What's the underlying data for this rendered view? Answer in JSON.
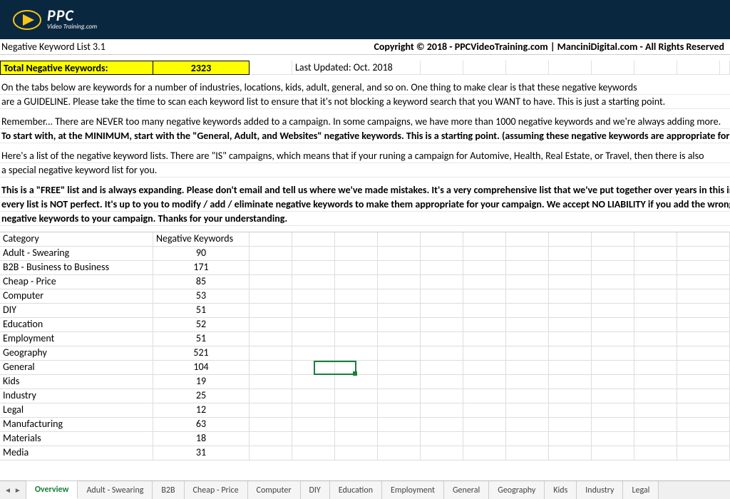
{
  "logo": {
    "main": "PPC",
    "sub": "Video Training.com"
  },
  "header": {
    "title": "Negative Keyword List 3.1",
    "copyright": "Copyright © 2018 - PPCVideoTraining.com | ManciniDigital.com - All Rights Reserved"
  },
  "summary": {
    "label": "Total Negative Keywords:",
    "value": "2323",
    "updated": "Last Updated: Oct. 2018"
  },
  "paragraphs": {
    "p1a": "On the tabs below are keywords for a number of industries, locations, kids, adult, general, and so on. One thing to make clear is that these negative keywords",
    "p1b": "are a GUIDELINE. Please take the time to scan each keyword list to ensure that it's not blocking a keyword search that you WANT to have. This is just a starting point.",
    "p2a": "Remember... There are NEVER too many negative keywords added to a campaign. In some campaigns, we have more than 1000 negative keywords and we're always adding more.",
    "p2b": "To start with, at the MINIMUM, start with the \"General, Adult, and Websites\" negative keywords. This is a starting point. (assuming these negative keywords are appropriate for y",
    "p3a": "Here's a list of the negative keyword lists. There are \"IS\" campaigns, which means that if your runing a campaign for Automive, Health, Real Estate, or Travel, then there is also",
    "p3b": "a special negative keyword list for you.",
    "p4a": "This is a \"FREE\" list and is always expanding. Please don't email and tell us where we've made mistakes. It's a very comprehensive list that we've put together over years in this in",
    "p4b": "every list is NOT perfect. It's up to you to modify / add / eliminate negative keywords to make them appropriate for your campaign. We accept NO LIABILITY if you add the wrong",
    "p4c": "negative keywords to your campaign. Thanks for your understanding."
  },
  "table": {
    "headers": {
      "category": "Category",
      "count": "Negative Keywords"
    },
    "rows": [
      {
        "category": "Adult - Swearing",
        "count": "90"
      },
      {
        "category": "B2B - Business to Business",
        "count": "171"
      },
      {
        "category": "Cheap - Price",
        "count": "85"
      },
      {
        "category": "Computer",
        "count": "53"
      },
      {
        "category": "DIY",
        "count": "51"
      },
      {
        "category": "Education",
        "count": "52"
      },
      {
        "category": "Employment",
        "count": "51"
      },
      {
        "category": "Geography",
        "count": "521"
      },
      {
        "category": "General",
        "count": "104"
      },
      {
        "category": "Kids",
        "count": "19"
      },
      {
        "category": "Industry",
        "count": "25"
      },
      {
        "category": "Legal",
        "count": "12"
      },
      {
        "category": "Manufacturing",
        "count": "63"
      },
      {
        "category": "Materials",
        "count": "18"
      },
      {
        "category": "Media",
        "count": "31"
      }
    ]
  },
  "tabs": [
    "Overview",
    "Adult - Swearing",
    "B2B",
    "Cheap - Price",
    "Computer",
    "DIY",
    "Education",
    "Employment",
    "General",
    "Geography",
    "Kids",
    "Industry",
    "Legal"
  ],
  "active_tab": "Overview"
}
